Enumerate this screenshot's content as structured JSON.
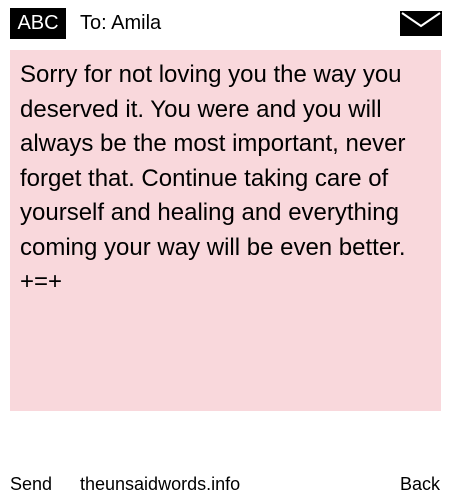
{
  "header": {
    "mode_label": "ABC",
    "recipient": "To: Amila",
    "icon": "envelope-icon"
  },
  "message": {
    "body": "Sorry for not loving you the way you deserved it. You were and you will always be the most important, never forget that. Continue taking care of yourself and healing and everything coming your way will be even better.\n+=+",
    "background_color": "#f9d8dc"
  },
  "footer": {
    "send_label": "Send",
    "site_label": "theunsaidwords.info",
    "back_label": "Back"
  }
}
